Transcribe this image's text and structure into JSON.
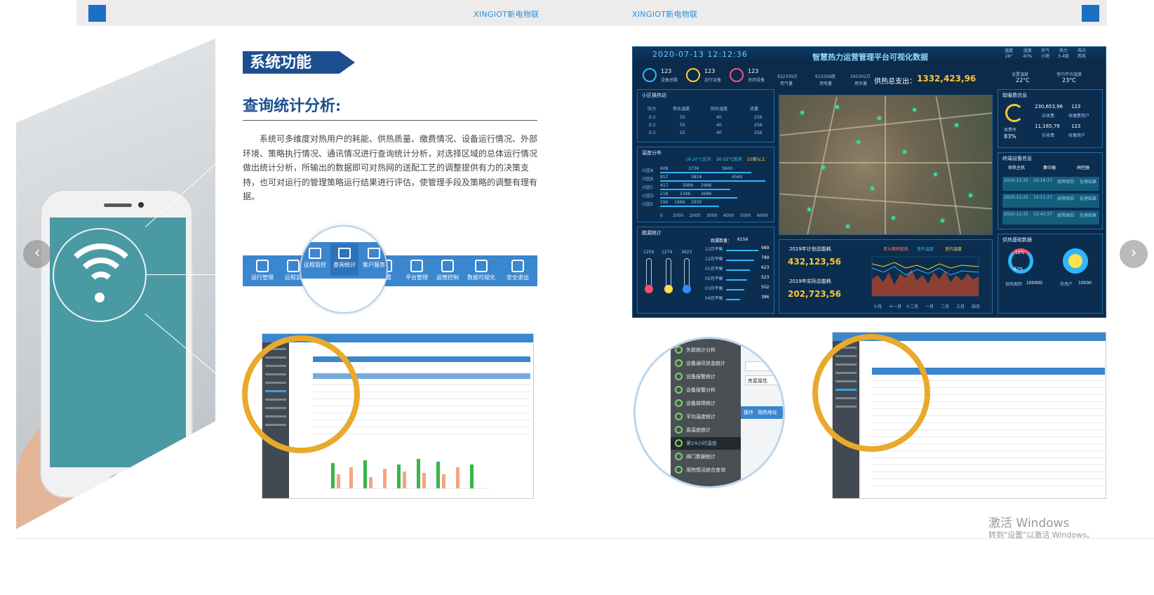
{
  "topbar": {
    "brand_1": "XINGIOT新电物联",
    "brand_2": "XINGIOT新电物联",
    "colors": {
      "accent": "#1b6fc4",
      "brand_text": "#2e8fd6"
    }
  },
  "nav": {
    "prev_icon": "chevron-left-icon",
    "next_icon": "chevron-right-icon",
    "prev_glyph": "‹",
    "next_glyph": "›"
  },
  "section": {
    "badge": "系统功能",
    "heading": "查询统计分析:",
    "paragraph": "系统可多维度对热用户的耗能、供热质量、缴费情况、设备运行情况、外部环境、策略执行情况、通讯情况进行查询统计分析，对选择区域的总体运行情况做出统计分析，所输出的数据即可对热网的送配工艺的调整提供有力的决策支持，也可对运行的管理策略运行结果进行评估，使管理手段及策略的调整有理有据。"
  },
  "menubar": {
    "items": [
      "运行管理",
      "远程监",
      "远程监控",
      "查询统计",
      "客户服务",
      "配置",
      "平台管理",
      "运营控制",
      "数据可视化",
      "安全退出"
    ],
    "magnified": [
      "远程监控",
      "查询统计",
      "客户服务"
    ]
  },
  "dashboard": {
    "datetime": "2020-07-13 12:12:36",
    "title": "智慧热力运营管理平台可视化数据",
    "weather": [
      {
        "label": "温度",
        "value": "28°"
      },
      {
        "label": "湿度",
        "value": "40%"
      },
      {
        "label": "天气",
        "value": "小雨"
      },
      {
        "label": "风力",
        "value": "3-4级"
      },
      {
        "label": "风向",
        "value": "西风"
      }
    ],
    "status": [
      {
        "label": "设备总数",
        "value": "123"
      },
      {
        "label": "运行设备",
        "value": "123"
      },
      {
        "label": "关闭设备",
        "value": "123"
      }
    ],
    "usage": [
      {
        "value": "922339方",
        "label": "用气量"
      },
      {
        "value": "623256度",
        "label": "用电量"
      },
      {
        "value": "292301方",
        "label": "用水量"
      }
    ],
    "total_label": "供热总支出：",
    "total_value": "1332,423,96",
    "set_temp": {
      "label": "设置温度",
      "value": "22°C"
    },
    "room_temp": {
      "label": "室内平均温度",
      "value": "23°C"
    },
    "community": {
      "title": "小区换热站",
      "headers": [
        "压力",
        "供水温度",
        "回水温度",
        "流量"
      ],
      "rows": [
        [
          "0.2",
          "55",
          "40",
          "256"
        ],
        [
          "0.2",
          "55",
          "40",
          "256"
        ],
        [
          "0.2",
          "55",
          "40",
          "256"
        ]
      ]
    },
    "temp_dist": {
      "title": "温度分布",
      "legend": [
        "18-20°C区间",
        "20-22°C区间",
        "25度以上"
      ],
      "rows": [
        {
          "label": "小区A",
          "values": [
            "608",
            "3736",
            "3600"
          ]
        },
        {
          "label": "小区B",
          "values": [
            "817",
            "3816",
            "4560"
          ]
        },
        {
          "label": "小区C",
          "values": [
            "417",
            "2996",
            "2996"
          ]
        },
        {
          "label": "小区D",
          "values": [
            "216",
            "2396",
            "3686"
          ]
        },
        {
          "label": "小区E",
          "values": [
            "190",
            "1996",
            "2930"
          ]
        }
      ],
      "axis": [
        "0",
        "1000",
        "2000",
        "3000",
        "4000",
        "5000",
        "6000"
      ]
    },
    "fee": {
      "title": "取暖费信息",
      "rate_label": "收费率",
      "rate": "83%",
      "items": [
        {
          "value": "230,653,96",
          "label": "应收费"
        },
        {
          "value": "11,165,79",
          "label": "实收费"
        }
      ],
      "users": [
        {
          "value": "123",
          "label": "收缴费用户"
        },
        {
          "value": "123",
          "label": "收缴用户"
        }
      ]
    },
    "terminal": {
      "title": "终端设备信息",
      "types": [
        "供热主机",
        "集中器",
        "阀控器"
      ],
      "events": [
        {
          "date": "2020-12-25",
          "time": "16:16:27",
          "status": "故障原因",
          "result": "处理结果"
        },
        {
          "date": "2020-12-25",
          "time": "15:11:27",
          "status": "故障原因",
          "result": "处理结果"
        },
        {
          "date": "2020-12-25",
          "time": "22:43:57",
          "status": "故障原因",
          "result": "处理结果"
        }
      ]
    },
    "leak": {
      "title": "跑漏统计",
      "total_label": "跑漏数量：",
      "total": "6156",
      "therm_values": [
        "1259",
        "1274",
        "3623"
      ],
      "months": [
        {
          "label": "11月平衡",
          "value": "989"
        },
        {
          "label": "12月平衡",
          "value": "789"
        },
        {
          "label": "01月平衡",
          "value": "623"
        },
        {
          "label": "02月平衡",
          "value": "523"
        },
        {
          "label": "03月平衡",
          "value": "502"
        },
        {
          "label": "04月平衡",
          "value": "386"
        }
      ]
    },
    "plan": {
      "label": "2019年计划总能耗",
      "value": "432,123,56",
      "actual_label": "2019年实际总能耗",
      "actual_value": "202,723,56"
    },
    "trend": {
      "legend": [
        "单元面积能耗",
        "室外温度",
        "室内温度"
      ],
      "months": [
        "十月",
        "十一月",
        "十二月",
        "一月",
        "二月",
        "三月",
        "四月"
      ]
    },
    "base": {
      "title": "供热基础数据",
      "ring1": "18%",
      "ring2": "82%",
      "items": [
        {
          "label": "供热面积",
          "value": "100000"
        },
        {
          "label": "热用户",
          "value": "10000"
        }
      ]
    }
  },
  "sidebar_zoom": {
    "items": [
      "失联统计分析",
      "设备通讯状态统计",
      "设备报警统计",
      "设备报警分析",
      "设备故障统计",
      "平均温度统计",
      "周温度统计",
      "第24小时温度",
      "阀门数据统计",
      "用热情况综合查询"
    ],
    "side_labels": [
      "房屋属性",
      "操作",
      "用热地址"
    ]
  },
  "watermark": {
    "line1": "激活 Windows",
    "line2": "转到\"设置\"以激活 Windows。"
  }
}
